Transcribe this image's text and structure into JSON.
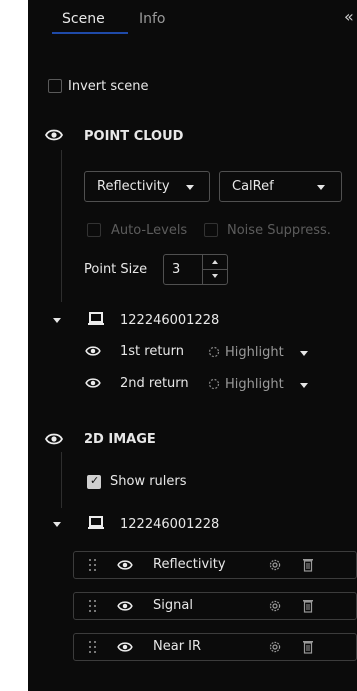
{
  "tabs": [
    {
      "label": "Scene",
      "active": true
    },
    {
      "label": "Info",
      "active": false
    }
  ],
  "collapse_glyph": "«",
  "invert_scene": {
    "label": "Invert scene",
    "checked": false
  },
  "point_cloud": {
    "title": "POINT CLOUD",
    "color_mode": "Reflectivity",
    "palette": "CalRef",
    "auto_levels": "Auto-Levels",
    "noise_suppress": "Noise Suppress.",
    "point_size_label": "Point Size",
    "point_size_value": "3",
    "sensor": {
      "id": "122246001228",
      "returns": [
        {
          "label": "1st return",
          "highlight": "Highlight"
        },
        {
          "label": "2nd return",
          "highlight": "Highlight"
        }
      ]
    }
  },
  "image_2d": {
    "title": "2D IMAGE",
    "show_rulers": {
      "label": "Show rulers",
      "checked": true
    },
    "sensor": {
      "id": "122246001228",
      "layers": [
        {
          "label": "Reflectivity"
        },
        {
          "label": "Signal"
        },
        {
          "label": "Near IR"
        }
      ]
    }
  },
  "colors": {
    "panel_bg": "#0b0b0b",
    "active_tab_underline": "#1f4aa8",
    "text": "#e8e8e8",
    "dim_text": "#5c5c5c"
  }
}
